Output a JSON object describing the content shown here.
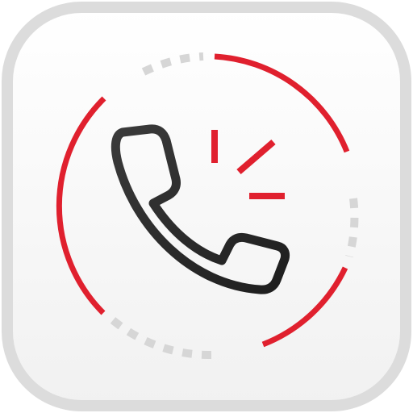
{
  "app_icon": {
    "icon_name": "phone-call-icon",
    "colors": {
      "accent_red": "#E0202E",
      "handset_dark": "#2B2B2B",
      "dotted_gray": "#D6D6D6",
      "tile_border": "#DCDCDC",
      "tile_fill_top": "#FFFFFF",
      "tile_fill_bottom": "#F1F1F1"
    }
  }
}
